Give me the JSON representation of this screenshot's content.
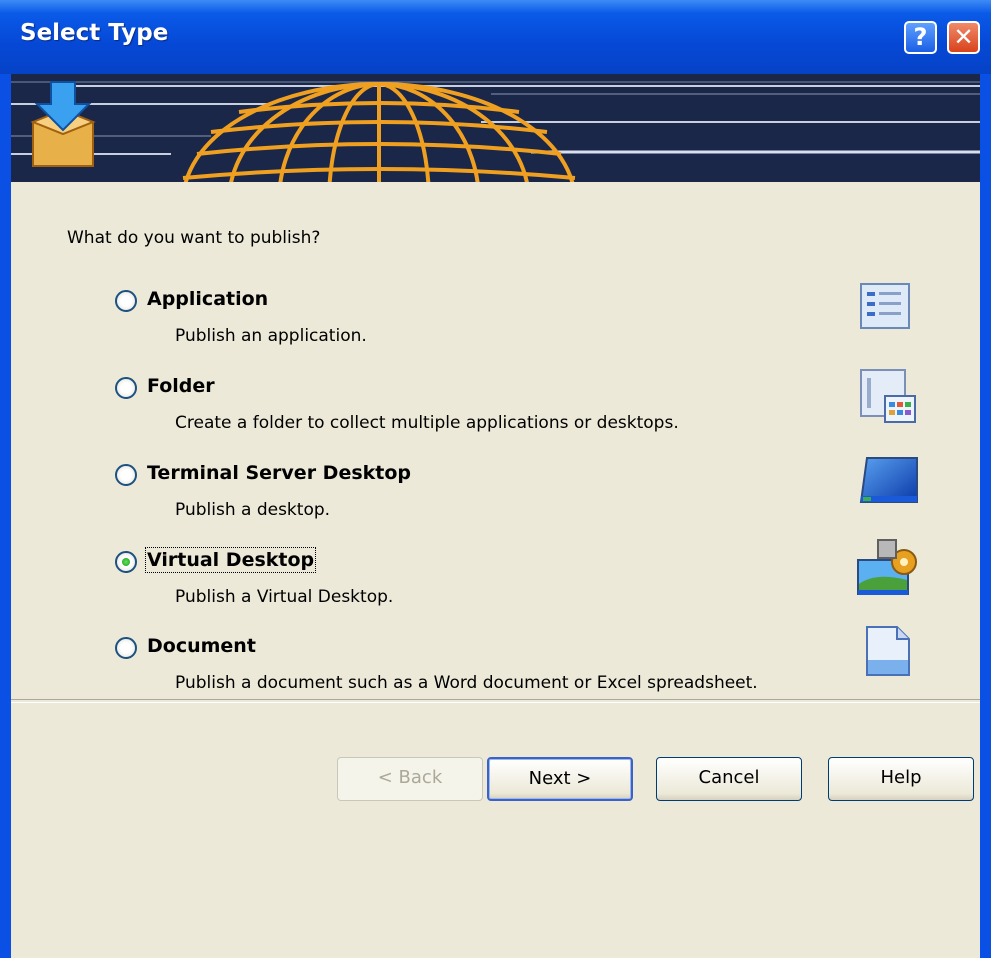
{
  "window": {
    "title": "Select Type"
  },
  "titlebar_buttons": {
    "help": "?",
    "close": "✕"
  },
  "prompt": "What do you want to publish?",
  "options": [
    {
      "label": "Application",
      "description": "Publish an application.",
      "selected": false,
      "icon": "application-list-icon"
    },
    {
      "label": "Folder",
      "description": "Create a folder to collect multiple applications or desktops.",
      "selected": false,
      "icon": "folder-apps-icon"
    },
    {
      "label": "Terminal Server Desktop",
      "description": "Publish a desktop.",
      "selected": false,
      "icon": "desktop-screen-icon"
    },
    {
      "label": "Virtual Desktop",
      "description": "Publish a Virtual Desktop.",
      "selected": true,
      "icon": "virtual-desktop-gear-icon"
    },
    {
      "label": "Document",
      "description": "Publish a document such as a Word document or Excel spreadsheet.",
      "selected": false,
      "icon": "document-icon"
    }
  ],
  "buttons": {
    "back": "< Back",
    "next": "Next >",
    "cancel": "Cancel",
    "help": "Help"
  },
  "colors": {
    "titlebar": "#0a5ae8",
    "banner": "#1a2748",
    "dialog_bg": "#ece9d8",
    "globe": "#f0a020"
  }
}
